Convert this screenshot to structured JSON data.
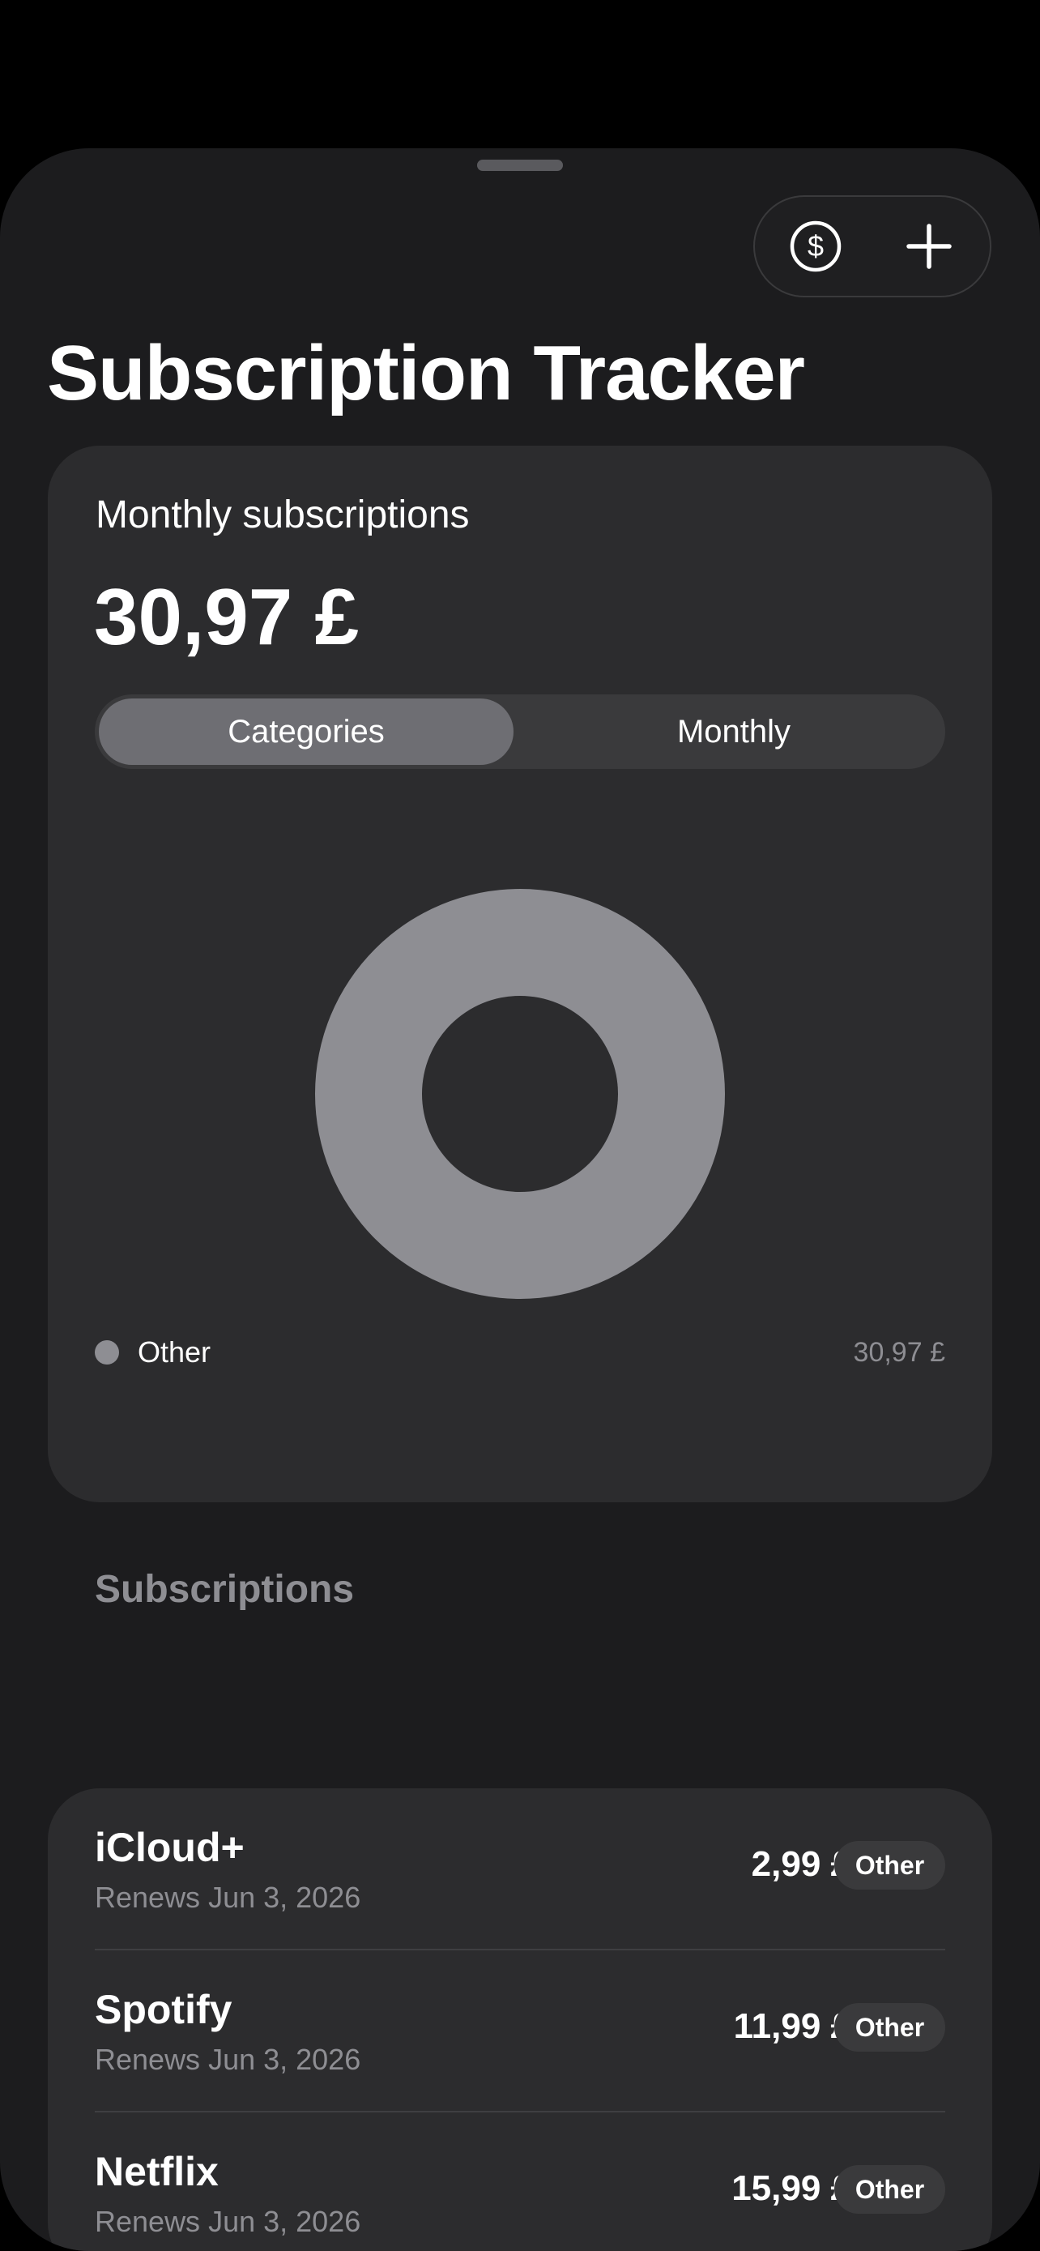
{
  "header": {
    "title": "Subscription Tracker",
    "currency_button_icon": "dollar-circle-icon",
    "add_button_icon": "plus-icon"
  },
  "summary": {
    "label": "Monthly subscriptions",
    "total": "30,97 £",
    "segments": [
      {
        "label": "Categories",
        "selected": true
      },
      {
        "label": "Monthly",
        "selected": false
      }
    ]
  },
  "chart_data": {
    "type": "pie",
    "donut": true,
    "slices": [
      {
        "name": "Other",
        "value": 30.97,
        "color": "#8e8e93"
      }
    ]
  },
  "legend": [
    {
      "name": "Other",
      "value": "30,97 £",
      "color": "#8e8e93"
    }
  ],
  "subscriptions": {
    "header": "Subscriptions",
    "items": [
      {
        "name": "iCloud+",
        "renews": "Renews Jun 3, 2026",
        "price": "2,99 £",
        "category": "Other"
      },
      {
        "name": "Spotify",
        "renews": "Renews Jun 3, 2026",
        "price": "11,99 £",
        "category": "Other"
      },
      {
        "name": "Netflix",
        "renews": "Renews Jun 3, 2026",
        "price": "15,99 £",
        "category": "Other"
      }
    ]
  },
  "colors": {
    "background": "#1c1c1e",
    "card": "#2c2c2e",
    "accent_gray": "#8e8e93"
  }
}
